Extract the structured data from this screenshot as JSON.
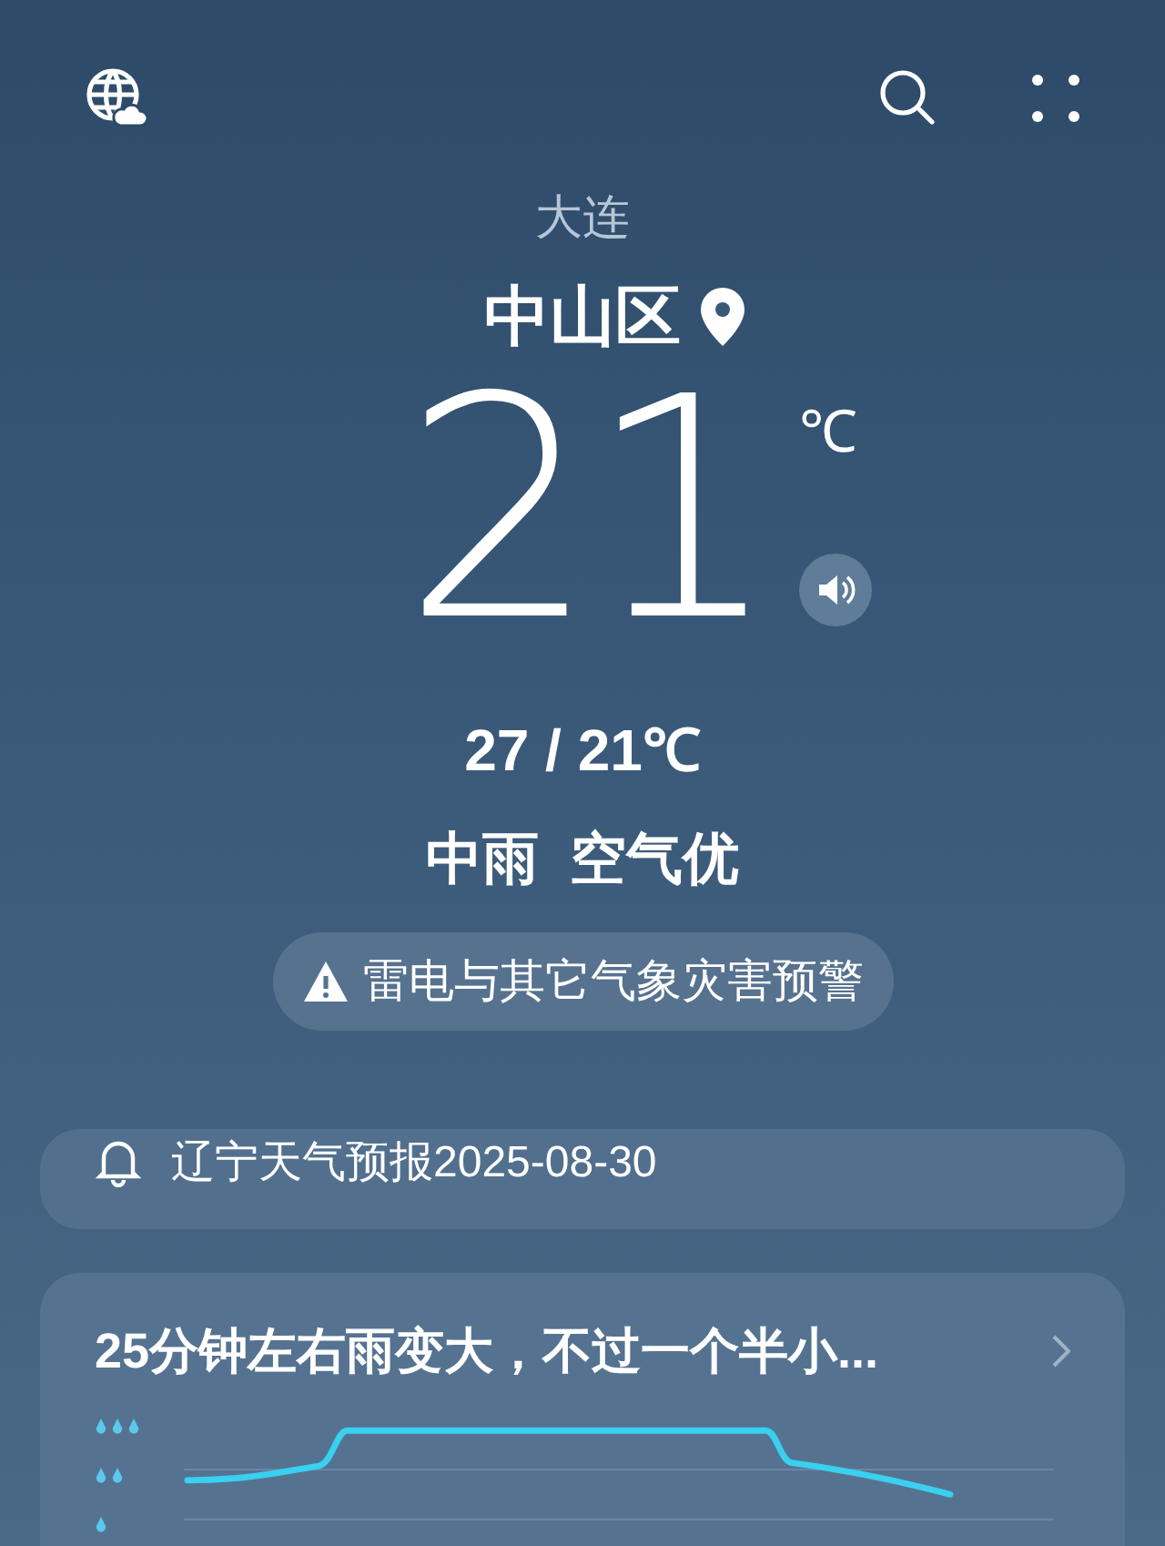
{
  "city": "大连",
  "district": "中山区",
  "temperature": {
    "value": "21",
    "unit": "℃"
  },
  "range": "27 / 21℃",
  "condition": "中雨  空气优",
  "alert": {
    "text": "雷电与其它气象灾害预警"
  },
  "notice": {
    "text": "辽宁天气预报2025-08-30"
  },
  "forecast_card": {
    "summary": "25分钟左右雨变大，不过一个半小..."
  }
}
